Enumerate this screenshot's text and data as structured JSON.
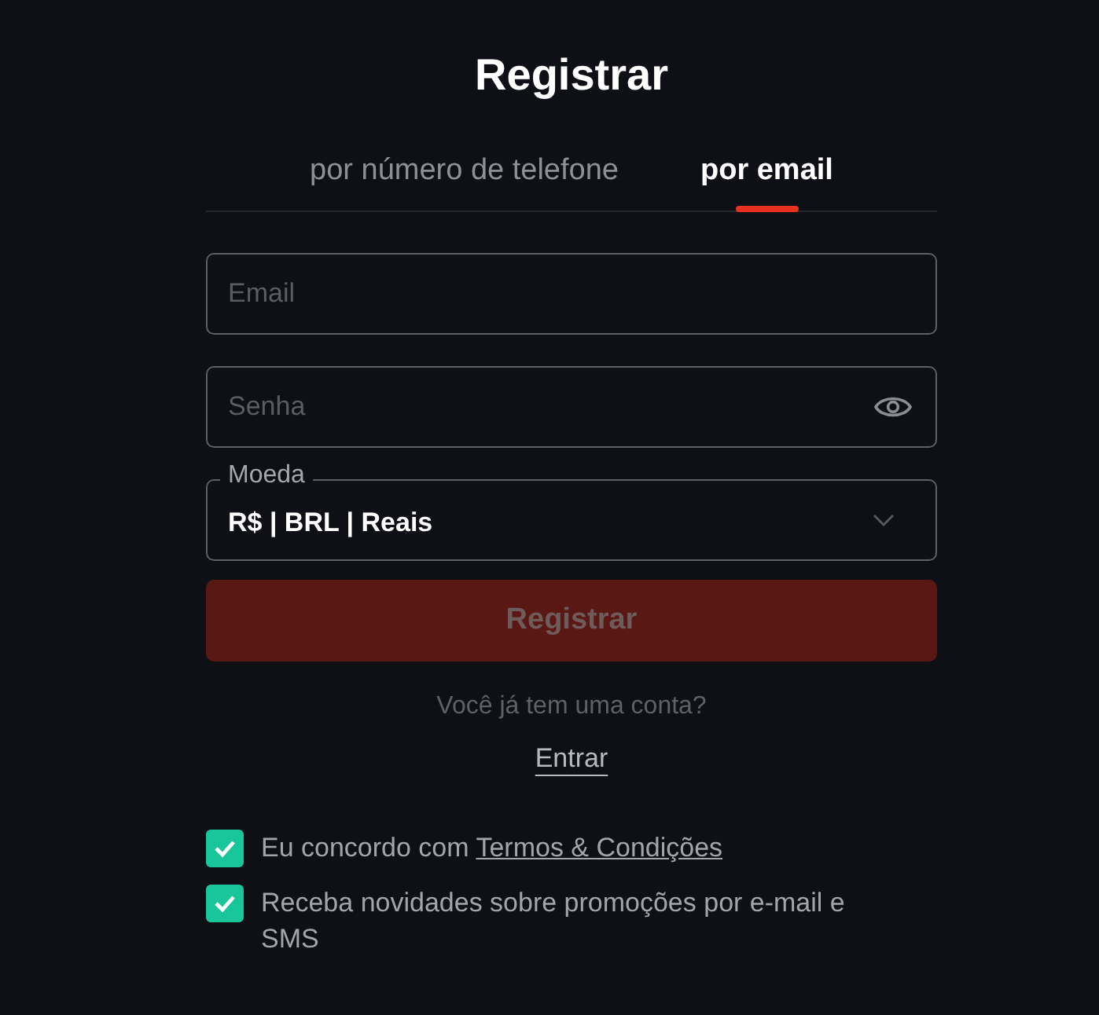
{
  "title": "Registrar",
  "tabs": [
    {
      "label": "por número de telefone",
      "selected": false
    },
    {
      "label": "por email",
      "selected": true
    }
  ],
  "email": {
    "placeholder": "Email"
  },
  "password": {
    "placeholder": "Senha"
  },
  "currency": {
    "label": "Moeda",
    "value": "R$ | BRL | Reais"
  },
  "submit": {
    "label": "Registrar",
    "disabled": true
  },
  "login_prompt": "Você já tem uma conta?",
  "login_link": "Entrar",
  "checkboxes": [
    {
      "text": "Eu concordo com ",
      "link": "Termos & Condições",
      "checked": true
    },
    {
      "text": "Receba novidades sobre promoções por e-mail e SMS",
      "checked": true
    }
  ]
}
